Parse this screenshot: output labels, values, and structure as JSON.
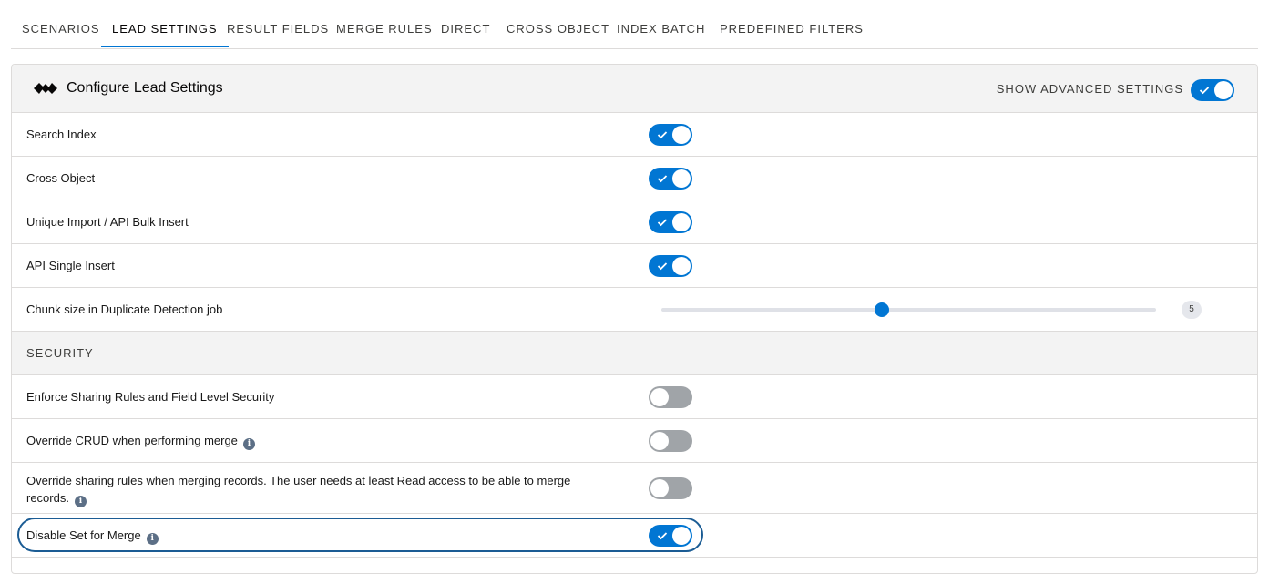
{
  "tabs": [
    {
      "label": "SCENARIOS",
      "active": false
    },
    {
      "label": "LEAD SETTINGS",
      "active": true
    },
    {
      "label": "RESULT FIELDS",
      "active": false
    },
    {
      "label": "MERGE RULES",
      "active": false
    },
    {
      "label": "DIRECT",
      "active": false
    },
    {
      "label": "CROSS OBJECT",
      "active": false
    },
    {
      "label": "INDEX BATCH",
      "active": false
    },
    {
      "label": "PREDEFINED FILTERS",
      "active": false
    }
  ],
  "header": {
    "title": "Configure Lead Settings",
    "advanced_label": "SHOW ADVANCED SETTINGS",
    "advanced_on": true,
    "logo_icon": "duplicate-check-logo-icon"
  },
  "settings": [
    {
      "label": "Search Index",
      "on": true
    },
    {
      "label": "Cross Object",
      "on": true
    },
    {
      "label": "Unique Import / API Bulk Insert",
      "on": true
    },
    {
      "label": "API Single Insert",
      "on": true
    }
  ],
  "chunk": {
    "label": "Chunk size in Duplicate Detection job",
    "value": "5",
    "fraction": 0.445
  },
  "security": {
    "section_label": "SECURITY",
    "rows": [
      {
        "label": "Enforce Sharing Rules and Field Level Security",
        "on": false,
        "info": false
      },
      {
        "label": "Override CRUD when performing merge",
        "on": false,
        "info": true
      },
      {
        "label": "Override sharing rules when merging records. The user needs at least Read access to be able to merge records.",
        "on": false,
        "info": true
      },
      {
        "label": "Disable Set for Merge",
        "on": true,
        "info": true,
        "focused": true
      }
    ]
  },
  "icons": {
    "check": "check-icon",
    "info": "info-icon"
  },
  "colors": {
    "accent": "#0176d3",
    "toggle_off": "#a0a4a8",
    "header_bg": "#f3f3f3",
    "focus": "#1b5c94"
  }
}
